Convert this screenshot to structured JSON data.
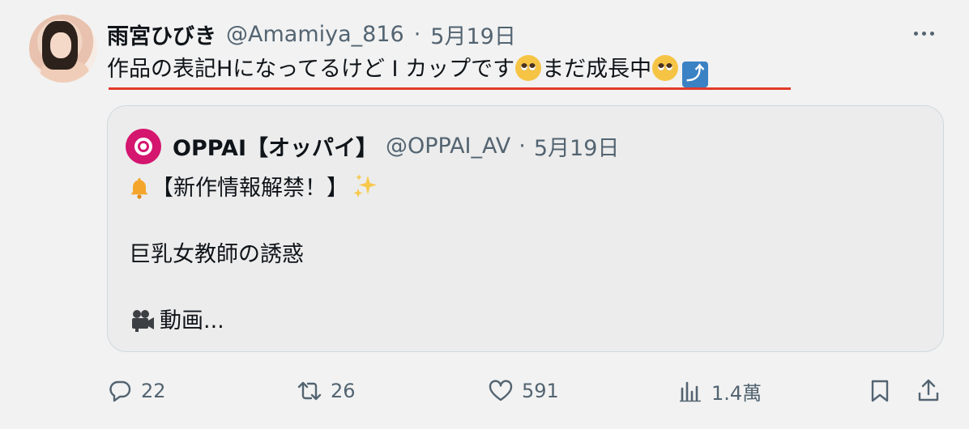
{
  "tweet": {
    "display_name": "雨宮ひびき",
    "handle": "@Amamiya_816",
    "separator": "·",
    "date": "5月19日",
    "text_part1": "作品の表記Hになってるけど I カップです",
    "text_part2": "まだ成長中"
  },
  "quote": {
    "display_name": "OPPAI【オッパイ】",
    "handle": "@OPPAI_AV",
    "separator": "·",
    "date": "5月19日",
    "line1": "【新作情報解禁！】",
    "line2": "巨乳女教師の誘惑",
    "line3": "動画..."
  },
  "actions": {
    "replies": "22",
    "retweets": "26",
    "likes": "591",
    "views": "1.4萬"
  },
  "icons": {
    "emoji1": "pleading-face",
    "emoji2": "pleading-face",
    "emoji3": "arrow-up-right-box",
    "quote_emoji1": "bell",
    "quote_emoji2": "sparkles",
    "quote_emoji3": "movie-camera"
  },
  "colors": {
    "underline": "#e23a2a",
    "muted": "#536471",
    "quote_avatar": "#d4166f"
  }
}
